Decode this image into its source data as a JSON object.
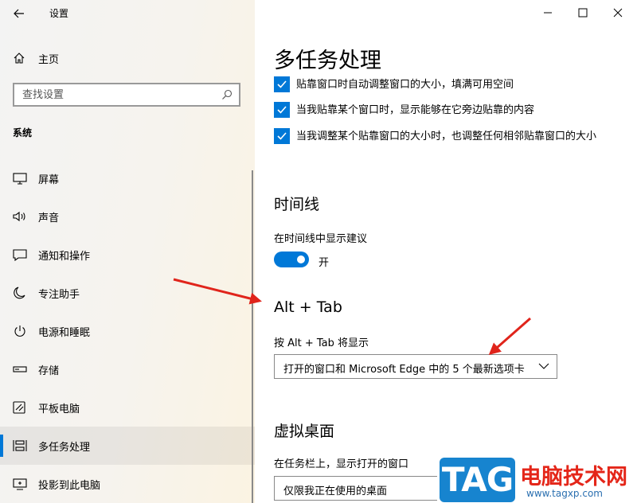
{
  "app": {
    "title": "设置"
  },
  "sidebar": {
    "home_label": "主页",
    "search_placeholder": "查找设置",
    "section_header": "系统",
    "items": [
      {
        "label": "屏幕",
        "icon": "monitor-icon"
      },
      {
        "label": "声音",
        "icon": "speaker-icon"
      },
      {
        "label": "通知和操作",
        "icon": "notification-icon"
      },
      {
        "label": "专注助手",
        "icon": "moon-icon"
      },
      {
        "label": "电源和睡眠",
        "icon": "power-icon"
      },
      {
        "label": "存储",
        "icon": "storage-icon"
      },
      {
        "label": "平板电脑",
        "icon": "tablet-icon"
      },
      {
        "label": "多任务处理",
        "icon": "multitasking-icon",
        "active": true
      },
      {
        "label": "投影到此电脑",
        "icon": "project-icon"
      }
    ]
  },
  "main": {
    "title": "多任务处理",
    "snap_options": [
      {
        "label": "贴靠窗口时自动调整窗口的大小，填满可用空间",
        "checked": true
      },
      {
        "label": "当我贴靠某个窗口时，显示能够在它旁边贴靠的内容",
        "checked": true
      },
      {
        "label": "当我调整某个贴靠窗口的大小时，也调整任何相邻贴靠窗口的大小",
        "checked": true
      }
    ],
    "timeline": {
      "title": "时间线",
      "suggest_label": "在时间线中显示建议",
      "toggle_state": "开"
    },
    "alttab": {
      "title": "Alt + Tab",
      "label": "按 Alt + Tab 将显示",
      "value": "打开的窗口和 Microsoft Edge 中的 5 个最新选项卡"
    },
    "virtual_desktops": {
      "title": "虚拟桌面",
      "taskbar_label": "在任务栏上，显示打开的窗口",
      "taskbar_value": "仅限我正在使用的桌面"
    }
  },
  "watermark": {
    "logo": "TAG",
    "title": "电脑技术网",
    "url": "www.tagxp.com"
  },
  "colors": {
    "accent": "#0078d7",
    "arrow": "#e0241b",
    "watermark_red": "#e42619",
    "watermark_blue": "#1784cf"
  }
}
